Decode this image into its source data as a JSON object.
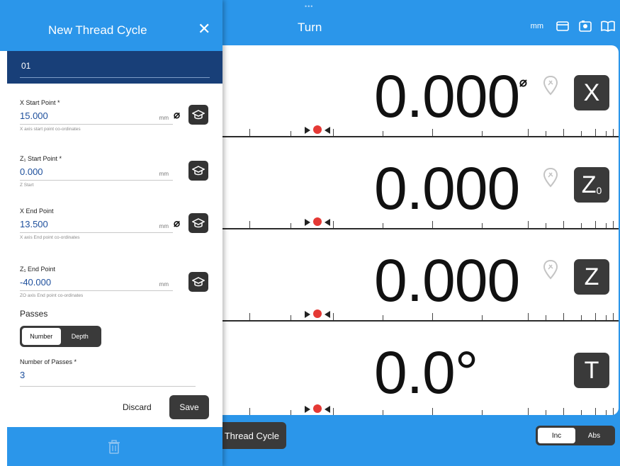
{
  "app": {
    "title": "Turn",
    "unit": "mm",
    "grab_handle": "•••",
    "icons": [
      "card-icon",
      "settings-card-icon",
      "book-icon"
    ],
    "accent": "#2b96ea",
    "dark": "#3a3a3a",
    "navy": "#183f78"
  },
  "axes": [
    {
      "value": "0.000",
      "diameter": "⌀",
      "button": "X",
      "sub": "",
      "dial_red": "#e53935"
    },
    {
      "value": "0.000",
      "diameter": "",
      "button": "Z",
      "sub": "0",
      "dial_red": "#e53935"
    },
    {
      "value": "0.000",
      "diameter": "",
      "button": "Z",
      "sub": "",
      "dial_red": "#e53935"
    },
    {
      "value": "0.0°",
      "diameter": "",
      "button": "T",
      "sub": "",
      "dial_red": "#e53935"
    }
  ],
  "bottom": {
    "thread_cycle": "Thread Cycle",
    "inc": "Inc",
    "abs": "Abs",
    "inc_abs_selected": "Inc"
  },
  "drawer": {
    "title": "New Thread Cycle",
    "close": "✕",
    "program": "01",
    "fields": [
      {
        "label": "X Start Point *",
        "value": "15.000",
        "unit": "mm",
        "hint": "X axis start point co-ordinates",
        "diameter": "⌀"
      },
      {
        "label": "Z₁ Start Point *",
        "value": "0.000",
        "unit": "mm",
        "hint": "Z Start",
        "diameter": ""
      },
      {
        "label": "X End Point",
        "value": "13.500",
        "unit": "mm",
        "hint": "X axis End point co-ordinates",
        "diameter": "⌀"
      },
      {
        "label": "Z₁ End Point",
        "value": "-40.000",
        "unit": "mm",
        "hint": "ZO axis End point co-ordinates",
        "diameter": ""
      }
    ],
    "passes_label": "Passes",
    "passes_toggle": {
      "number": "Number",
      "depth": "Depth",
      "selected": "Number"
    },
    "num_passes": {
      "label": "Number of Passes *",
      "value": "3"
    },
    "discard": "Discard",
    "save": "Save"
  }
}
